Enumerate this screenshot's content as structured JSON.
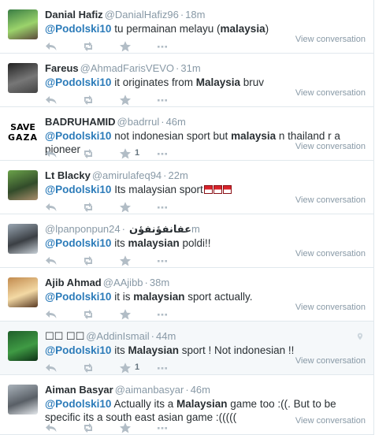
{
  "view_conversation_label": "View conversation",
  "colors": {
    "mention": "#2b7bb9",
    "muted": "#8899a6",
    "border": "#e1e8ed",
    "highlight_bg": "#f5f8fa"
  },
  "tweets": [
    {
      "fullname": "Danial Hafiz",
      "username": "@DanialHafiz96",
      "time": "18m",
      "text": [
        [
          "@Podolski10",
          "mention"
        ],
        [
          " tu permainan melayu ("
        ],
        [
          "malaysia",
          "kw"
        ],
        [
          ")"
        ]
      ],
      "fav_count": ""
    },
    {
      "fullname": "Fareus",
      "username": "@AhmadFarisVEVO",
      "time": "31m",
      "text": [
        [
          "@Podolski10",
          "mention"
        ],
        [
          " it originates from "
        ],
        [
          "Malaysia",
          "kw"
        ],
        [
          " bruv"
        ]
      ],
      "fav_count": ""
    },
    {
      "fullname": "BADRUHAMID",
      "username": "@badrrul",
      "time": "46m",
      "text": [
        [
          "@Podolski10",
          "mention"
        ],
        [
          " not indonesian sport but "
        ],
        [
          "malaysia",
          "kw"
        ],
        [
          " n thailand r a pioneer"
        ]
      ],
      "fav_count": "1",
      "avatar_text": [
        "SAVE",
        "GAZA"
      ]
    },
    {
      "fullname": "Lt Blacky",
      "username": "@amirulafeq94",
      "time": "22m",
      "text": [
        [
          "@Podolski10",
          "mention"
        ],
        [
          " Its malaysian sport"
        ]
      ],
      "emoji_count": 3,
      "fav_count": ""
    },
    {
      "fullname": "",
      "username": "@lpanponpun",
      "arabic_name": "عفانفؤنفؤن",
      "time": "24m",
      "text": [
        [
          "@Podolski10",
          "mention"
        ],
        [
          " its "
        ],
        [
          "malaysian",
          "kw"
        ],
        [
          " poldi!!"
        ]
      ],
      "fav_count": ""
    },
    {
      "fullname": "Ajib Ahmad",
      "username": "@AAjibb",
      "time": "38m",
      "text": [
        [
          "@Podolski10",
          "mention"
        ],
        [
          " it is "
        ],
        [
          "malaysian",
          "kw"
        ],
        [
          " sport actually."
        ]
      ],
      "fav_count": ""
    },
    {
      "fullname": "☐☐ ☐☐",
      "username": "@AddinIsmail",
      "time": "44m",
      "text": [
        [
          "@Podolski10",
          "mention"
        ],
        [
          " its "
        ],
        [
          "Malaysian",
          "kw"
        ],
        [
          " sport ! Not indonesian !!"
        ]
      ],
      "fav_count": "1",
      "geo": true,
      "highlight": true
    },
    {
      "fullname": "Aiman Basyar",
      "username": "@aimanbasyar",
      "time": "46m",
      "text": [
        [
          "@Podolski10",
          "mention"
        ],
        [
          " Actually its a "
        ],
        [
          "Malaysian",
          "kw"
        ],
        [
          " game too :((. But to be specific its a south east asian game :(((((  "
        ]
      ],
      "fav_count": ""
    }
  ]
}
